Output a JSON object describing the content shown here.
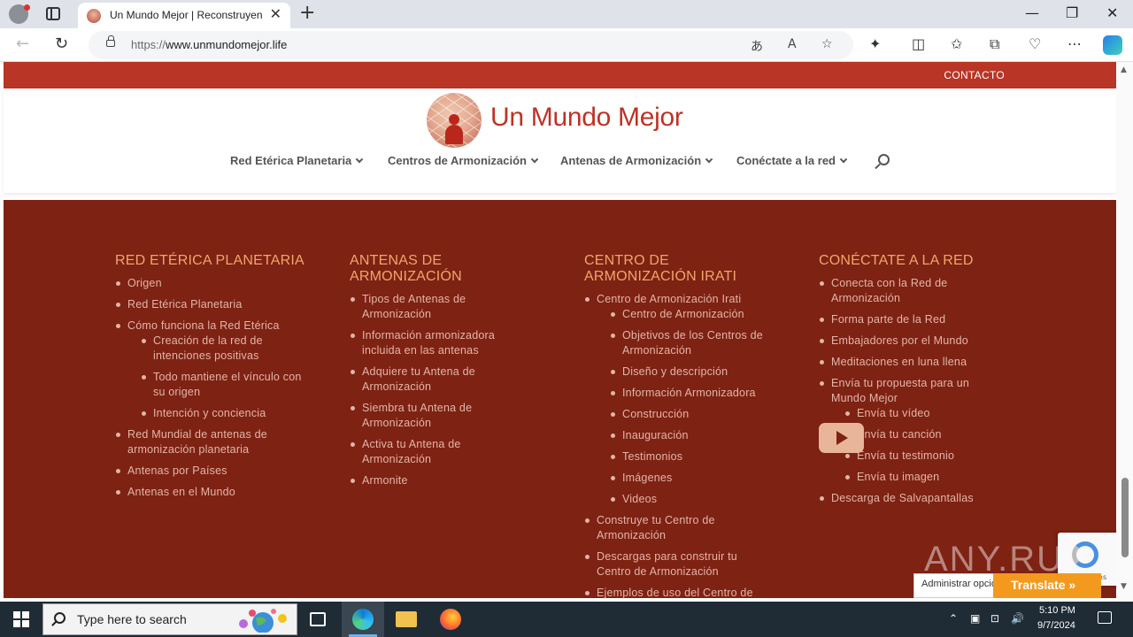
{
  "browser": {
    "tab_title": "Un Mundo Mejor | Reconstruyendo",
    "tab_close": "✕",
    "new_tab": "+",
    "url_prefix": "https://",
    "url_host": "www.unmundomejor.life",
    "controls": {
      "minimize": "—",
      "restore": "❐",
      "close": "✕"
    },
    "back": "←",
    "refresh": "↻"
  },
  "site": {
    "topbar_link": "CONTACTO",
    "logo_text": "Un Mundo Mejor",
    "menu": [
      {
        "label": "Red Etérica Planetaria"
      },
      {
        "label": "Centros de Armonización"
      },
      {
        "label": "Antenas de Armonización"
      },
      {
        "label": "Conéctate a la red"
      }
    ]
  },
  "footer": {
    "col1": {
      "title": "RED ETÉRICA PLANETARIA",
      "items": [
        {
          "label": "Origen"
        },
        {
          "label": "Red Etérica Planetaria"
        },
        {
          "label": "Cómo funciona la Red Etérica"
        },
        {
          "label": "Creación de la red de intenciones positivas"
        },
        {
          "label": "Todo mantiene el vínculo con su origen"
        },
        {
          "label": "Intención y conciencia"
        },
        {
          "label": "Red Mundial de antenas de armonización planetaria"
        },
        {
          "label": "Antenas por Países"
        },
        {
          "label": "Antenas en el Mundo"
        }
      ]
    },
    "col2": {
      "title": "ANTENAS DE ARMONIZACIÓN",
      "items": [
        {
          "label": "Tipos de Antenas de Armonización"
        },
        {
          "label": "Información armonizadora incluida en las antenas"
        },
        {
          "label": "Adquiere tu Antena de Armonización"
        },
        {
          "label": "Siembra tu Antena de Armonización"
        },
        {
          "label": "Activa tu Antena de Armonización"
        },
        {
          "label": "Armonite"
        }
      ]
    },
    "col3": {
      "title": "CENTRO DE ARMONIZACIÓN IRATI",
      "items": [
        {
          "label": "Centro de Armonización Irati"
        },
        {
          "label": "Centro de Armonización"
        },
        {
          "label": "Objetivos de los Centros de Armonización"
        },
        {
          "label": "Diseño y descripción"
        },
        {
          "label": "Información Armonizadora"
        },
        {
          "label": "Construcción"
        },
        {
          "label": "Inauguración"
        },
        {
          "label": "Testimonios"
        },
        {
          "label": "Imágenes"
        },
        {
          "label": "Videos"
        },
        {
          "label": "Construye tu Centro de Armonización"
        },
        {
          "label": "Descargas para construir tu Centro de Armonización"
        },
        {
          "label": "Ejemplos de uso del Centro de"
        }
      ]
    },
    "col4": {
      "title": "CONÉCTATE A LA RED",
      "items": [
        {
          "label": "Conecta con la Red de Armonización"
        },
        {
          "label": "Forma parte de la Red"
        },
        {
          "label": "Embajadores por el Mundo"
        },
        {
          "label": "Meditaciones en luna llena"
        },
        {
          "label": "Envía tu propuesta para un Mundo Mejor"
        },
        {
          "label": "Envía tu vídeo"
        },
        {
          "label": "Envía tu canción"
        },
        {
          "label": "Envía tu testimonio"
        },
        {
          "label": "Envía tu imagen"
        },
        {
          "label": "Descarga de Salvapantallas"
        }
      ]
    }
  },
  "widgets": {
    "recaptcha_terms": "rms",
    "translate_options": "Administrar opciones",
    "translate_button": "Translate »",
    "watermark": "ANY.RUN"
  },
  "taskbar": {
    "search_placeholder": "Type here to search",
    "time": "5:10 PM",
    "date": "9/7/2024"
  },
  "colors": {
    "brand_red": "#b93525",
    "footer_bg": "#7e2213",
    "footer_heading": "#f3a56b",
    "translate_orange": "#f39a1e"
  }
}
